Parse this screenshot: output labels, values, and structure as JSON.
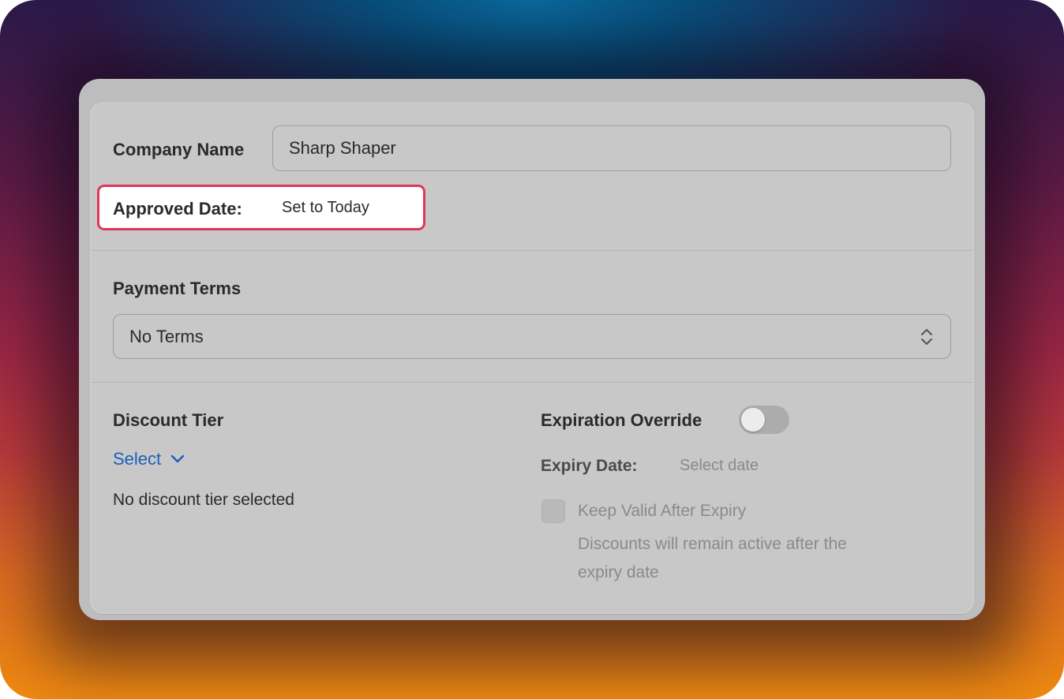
{
  "company": {
    "label": "Company Name",
    "value": "Sharp Shaper"
  },
  "approved_date": {
    "label": "Approved Date:",
    "button_label": "Set to Today"
  },
  "payment_terms": {
    "label": "Payment Terms",
    "selected": "No Terms"
  },
  "discount": {
    "label": "Discount Tier",
    "select_label": "Select",
    "empty_text": "No discount tier selected"
  },
  "expiration": {
    "label": "Expiration Override",
    "toggle_on": false,
    "expiry_label": "Expiry Date:",
    "expiry_placeholder": "Select date",
    "keep_valid_label": "Keep Valid After Expiry",
    "keep_valid_checked": false,
    "keep_valid_help_line1": "Discounts will remain active after the",
    "keep_valid_help_line2": "expiry date"
  },
  "colors": {
    "highlight_border": "#e0365a",
    "link": "#1a5fb8"
  },
  "icons": {
    "select_arrows": "chevron-up-down-icon",
    "dropdown": "chevron-down-icon"
  }
}
